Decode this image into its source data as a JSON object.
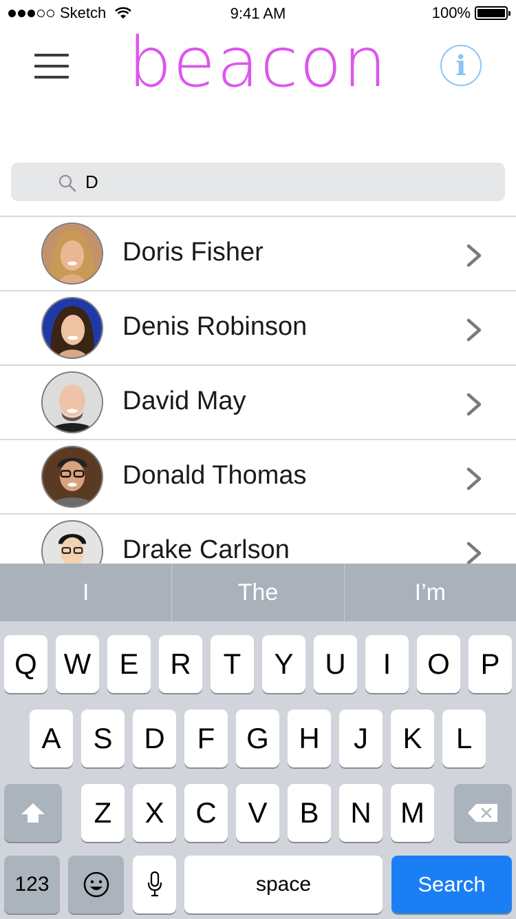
{
  "status_bar": {
    "carrier": "Sketch",
    "time": "9:41 AM",
    "battery": "100%"
  },
  "header": {
    "logo": "beacon",
    "info_icon": "i"
  },
  "search": {
    "value": "D",
    "placeholder": ""
  },
  "contacts": [
    {
      "name": "Doris Fisher"
    },
    {
      "name": "Denis Robinson"
    },
    {
      "name": "David May"
    },
    {
      "name": "Donald Thomas"
    },
    {
      "name": "Drake Carlson"
    }
  ],
  "keyboard": {
    "predictions": [
      "I",
      "The",
      "I’m"
    ],
    "row1": [
      "Q",
      "W",
      "E",
      "R",
      "T",
      "Y",
      "U",
      "I",
      "O",
      "P"
    ],
    "row2": [
      "A",
      "S",
      "D",
      "F",
      "G",
      "H",
      "J",
      "K",
      "L"
    ],
    "row3": [
      "Z",
      "X",
      "C",
      "V",
      "B",
      "N",
      "M"
    ],
    "numbers_label": "123",
    "space_label": "space",
    "search_label": "Search"
  },
  "colors": {
    "logo": "#dd55ee",
    "info": "#8cc4f4",
    "search_key": "#1a7ff5",
    "keyboard_bg": "#d1d5db"
  }
}
